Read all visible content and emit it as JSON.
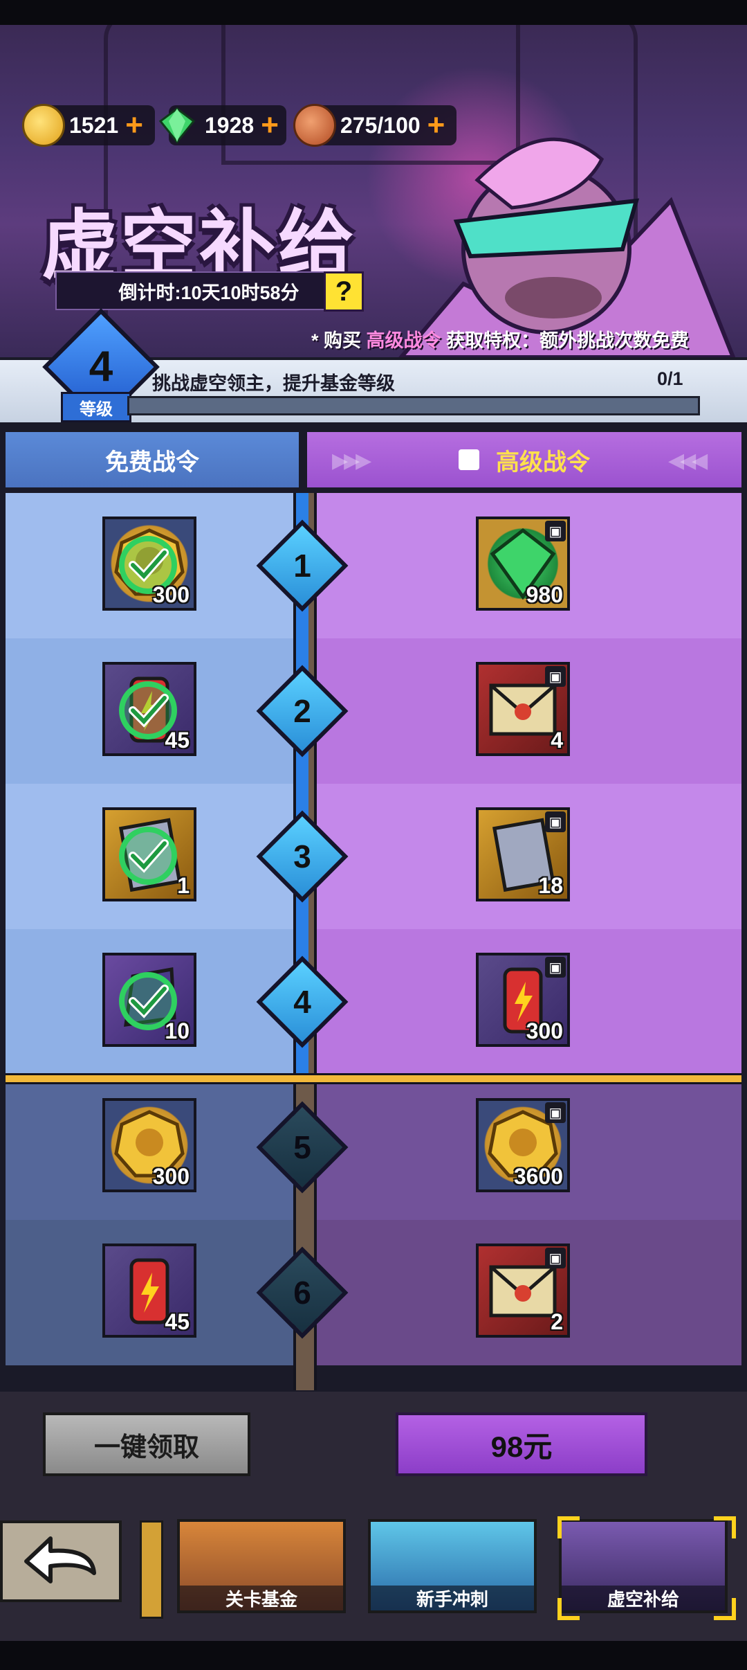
{
  "currency": [
    {
      "icon": "skull-coin-icon",
      "value": "1521"
    },
    {
      "icon": "gem-icon",
      "value": "1928"
    },
    {
      "icon": "meat-stamina-icon",
      "value": "275/100"
    }
  ],
  "plus_symbol": "+",
  "header": {
    "title": "虚空补给",
    "countdown": "倒计时:10天10时58分",
    "help_label": "?",
    "promo_prefix": "* 购买",
    "promo_highlight": "高级战令",
    "promo_suffix": "获取特权：额外挑战次数免费"
  },
  "level": {
    "number": "4",
    "label": "等级",
    "task": "挑战虚空领主，提升基金等级",
    "progress_text": "0/1",
    "progress_fraction": 0
  },
  "columns": {
    "free": "免费战令",
    "premium": "高级战令"
  },
  "tiers": [
    {
      "num": "1",
      "free": {
        "icon": "skull-coin-icon",
        "qty": "300",
        "claimed": true
      },
      "premium": {
        "icon": "gem-icon",
        "qty": "980",
        "locked": true
      }
    },
    {
      "num": "2",
      "free": {
        "icon": "energy-can-icon",
        "qty": "45",
        "claimed": true
      },
      "premium": {
        "icon": "envelope-icon",
        "qty": "4",
        "locked": true
      }
    },
    {
      "num": "3",
      "free": {
        "icon": "hero-card-icon",
        "qty": "1",
        "claimed": true
      },
      "premium": {
        "icon": "hero-card-icon",
        "qty": "18",
        "locked": true
      }
    },
    {
      "num": "4",
      "free": {
        "icon": "shard-icon",
        "qty": "10",
        "claimed": true
      },
      "premium": {
        "icon": "energy-can-icon",
        "qty": "300",
        "locked": true
      }
    },
    {
      "num": "5",
      "free": {
        "icon": "skull-coin-icon",
        "qty": "300",
        "claimed": false
      },
      "premium": {
        "icon": "skull-coin-icon",
        "qty": "3600",
        "locked": true
      }
    },
    {
      "num": "6",
      "free": {
        "icon": "energy-can-icon",
        "qty": "45",
        "claimed": false
      },
      "premium": {
        "icon": "envelope-icon",
        "qty": "2",
        "locked": true
      }
    }
  ],
  "buttons": {
    "claim_all": "一键领取",
    "price": "98元"
  },
  "nav_tabs": [
    {
      "label": "关卡基金",
      "active": false
    },
    {
      "label": "新手冲刺",
      "active": false
    },
    {
      "label": "虚空补给",
      "active": true
    }
  ],
  "colors": {
    "free_bg": "#9fb8ea",
    "premium_bg": "#c688e8",
    "accent_orange": "#ff9a1a",
    "diamond_active": "#4ab8ee",
    "diamond_locked": "#1c3a4c"
  }
}
